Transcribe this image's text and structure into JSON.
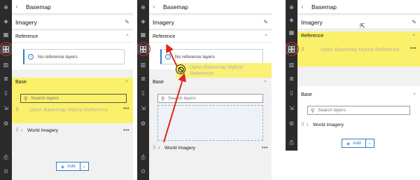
{
  "panels": [
    {
      "id": "before",
      "header_title": "Basemap",
      "basemap_name": "Imagery",
      "reference": {
        "label": "Reference",
        "notice": "No reference layers"
      },
      "base": {
        "label": "Base",
        "search_placeholder": "Search layers",
        "dragging_layer": "Open Basemap Hybrid Reference",
        "layers": [
          "World Imagery"
        ]
      },
      "add_label": "Add"
    },
    {
      "id": "during",
      "header_title": "Basemap",
      "basemap_name": "Imagery",
      "reference": {
        "label": "Reference",
        "notice": "No reference layers"
      },
      "drag_ghost": "Open Basemap Hybrid Reference",
      "base": {
        "label": "Base",
        "search_placeholder": "Search layers",
        "layers": [
          "World Imagery"
        ]
      }
    },
    {
      "id": "after",
      "header_title": "Basemap",
      "basemap_name": "Imagery",
      "reference": {
        "label": "Reference",
        "layers": [
          "Open Basemap Hybrid Reference"
        ]
      },
      "base": {
        "label": "Base",
        "search_placeholder": "Search layers",
        "layers": [
          "World Imagery"
        ]
      },
      "add_label": "Add"
    }
  ],
  "colors": {
    "highlight": "#fbf06a",
    "accent": "#2e7bc4",
    "annotation": "#e0241b",
    "rail": "#2b2b2b"
  },
  "icons": {
    "rail": [
      "add-layer-icon",
      "layers-icon",
      "table-icon",
      "basemap-icon",
      "chart-icon",
      "list-icon",
      "bookmark-icon",
      "share-icon",
      "settings-icon",
      "print-icon",
      "help-icon"
    ],
    "back": "chevron-left-icon",
    "edit": "pencil-icon",
    "drag": "grip-icon",
    "more": "ellipsis-icon",
    "info": "info-icon",
    "search": "search-icon",
    "blocked": "no-drop-icon"
  }
}
